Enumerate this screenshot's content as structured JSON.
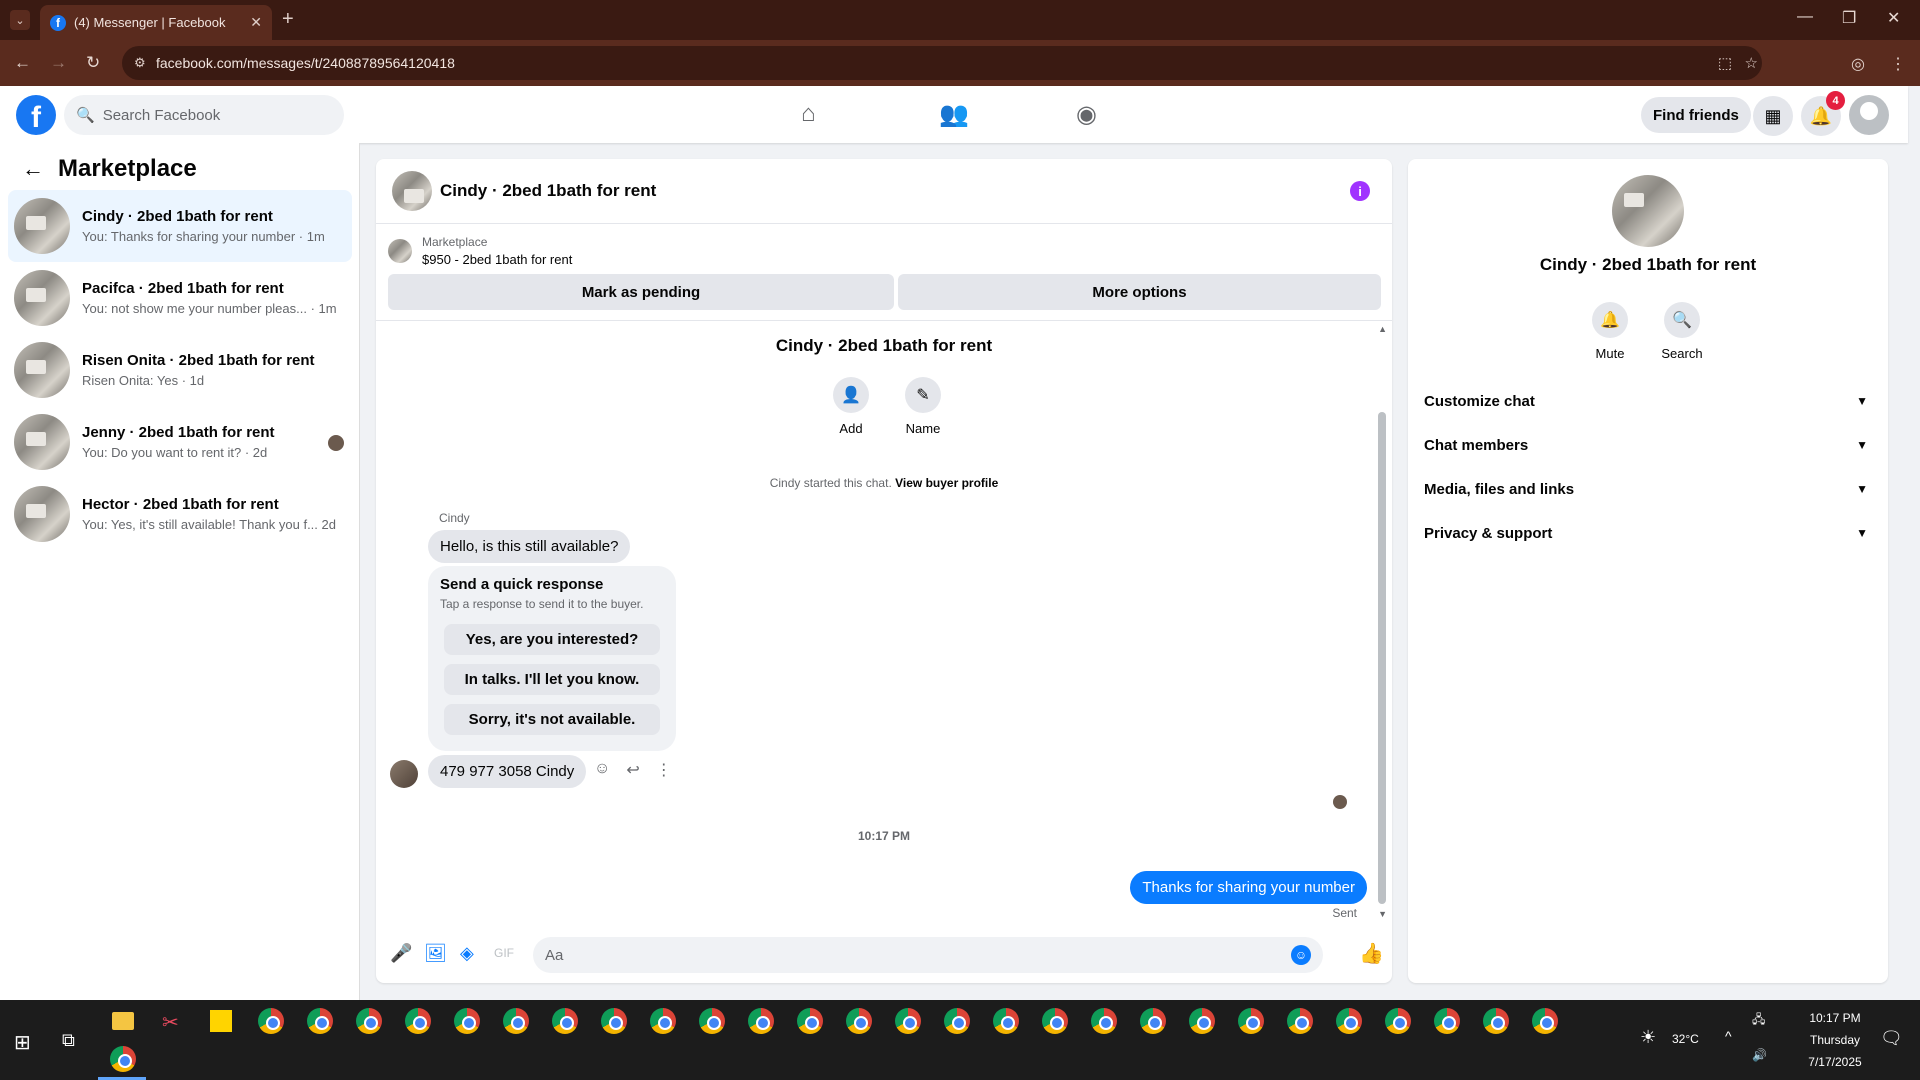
{
  "browser": {
    "tab_title": "(4) Messenger | Facebook",
    "url": "facebook.com/messages/t/24088789564120418"
  },
  "fb_header": {
    "search_placeholder": "Search Facebook",
    "find_friends": "Find friends",
    "notification_count": "4"
  },
  "sidebar": {
    "title": "Marketplace",
    "conversations": [
      {
        "name": "Cindy · 2bed 1bath for rent",
        "snippet": "You: Thanks for sharing your number · 1m",
        "active": true
      },
      {
        "name": "Pacifca · 2bed 1bath for rent",
        "snippet": "You: not show me your number pleas... · 1m",
        "active": false
      },
      {
        "name": "Risen Onita · 2bed 1bath for rent",
        "snippet": "Risen Onita: Yes · 1d",
        "active": false
      },
      {
        "name": "Jenny · 2bed 1bath for rent",
        "snippet": "You: Do you want to rent it? · 2d",
        "active": false
      },
      {
        "name": "Hector · 2bed 1bath for rent",
        "snippet": "You: Yes, it's still available! Thank you f... 2d",
        "active": false
      }
    ]
  },
  "chat": {
    "title": "Cindy · 2bed 1bath for rent",
    "marketplace_label": "Marketplace",
    "listing": "$950 - 2bed 1bath for rent",
    "mark_pending": "Mark as pending",
    "more_options": "More options",
    "intro_name": "Cindy · 2bed 1bath for rent",
    "add_label": "Add",
    "name_label": "Name",
    "started_text": "Cindy started this chat.",
    "view_buyer": "View buyer profile",
    "sender": "Cindy",
    "message_1": "Hello, is this still available?",
    "quick_title": "Send a quick response",
    "quick_sub": "Tap a response to send it to the buyer.",
    "quick_responses": [
      "Yes, are you interested?",
      "In talks. I'll let you know.",
      "Sorry, it's not available."
    ],
    "message_2": "479 977 3058 Cindy",
    "timestamp": "10:17 PM",
    "my_message": "Thanks for sharing your number",
    "sent": "Sent",
    "composer_placeholder": "Aa"
  },
  "details": {
    "name": "Cindy · 2bed 1bath for rent",
    "mute": "Mute",
    "search": "Search",
    "sections": [
      "Customize chat",
      "Chat members",
      "Media, files and links",
      "Privacy & support"
    ]
  },
  "taskbar": {
    "temperature": "32°C",
    "time": "10:17 PM",
    "day": "Thursday",
    "date": "7/17/2025"
  }
}
